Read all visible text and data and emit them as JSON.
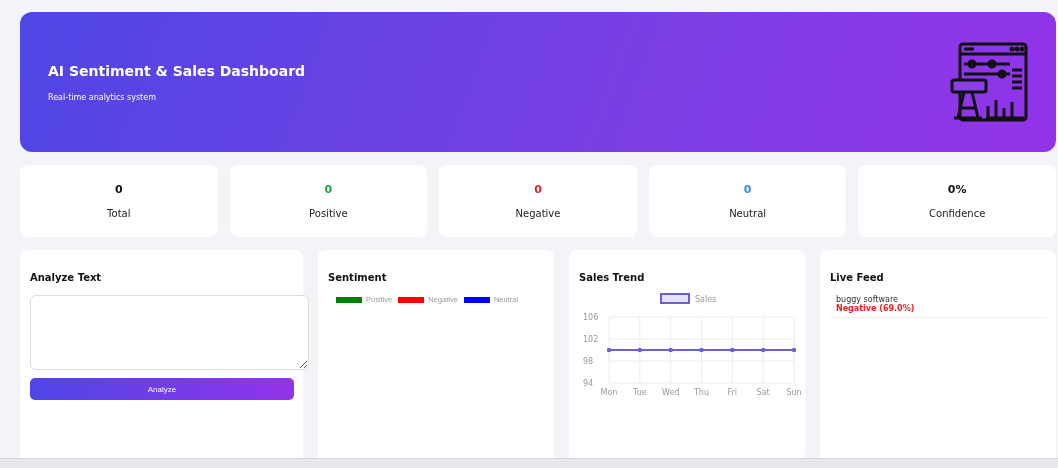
{
  "header": {
    "title": "AI Sentiment & Sales Dashboard",
    "subtitle": "Real-time analytics system"
  },
  "stats": [
    {
      "value": "0",
      "label": "Total",
      "color": "#111111"
    },
    {
      "value": "0",
      "label": "Positive",
      "color": "#22a33a"
    },
    {
      "value": "0",
      "label": "Negative",
      "color": "#e02424"
    },
    {
      "value": "0",
      "label": "Neutral",
      "color": "#3b82f6"
    },
    {
      "value": "0%",
      "label": "Confidence",
      "color": "#111111"
    }
  ],
  "analyze": {
    "title": "Analyze Text",
    "button": "Analyze"
  },
  "sentiment": {
    "title": "Sentiment",
    "legend": [
      {
        "label": "Positive",
        "color": "#008000"
      },
      {
        "label": "Negative",
        "color": "#ff0000"
      },
      {
        "label": "Neutral",
        "color": "#0000ff"
      }
    ]
  },
  "sales": {
    "title": "Sales Trend",
    "chart_data": {
      "type": "line",
      "categories": [
        "Mon",
        "Tue",
        "Wed",
        "Thu",
        "Fri",
        "Sat",
        "Sun"
      ],
      "series": [
        {
          "name": "Sales",
          "color": "#6b5fd6",
          "values": [
            100,
            100,
            100,
            100,
            100,
            100,
            100
          ]
        }
      ],
      "ylim": [
        94,
        106
      ],
      "yticks": [
        94,
        98,
        102,
        106
      ],
      "grid": true
    }
  },
  "feed": {
    "title": "Live Feed",
    "items": [
      {
        "text": "buggy software",
        "result": "Negative (69.0%)",
        "color": "#e02424"
      }
    ]
  }
}
